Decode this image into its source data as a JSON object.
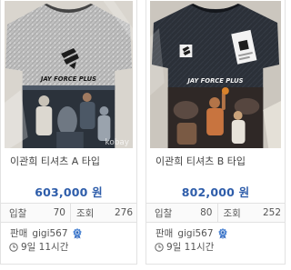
{
  "labels": {
    "bids": "입찰",
    "views": "조회",
    "seller": "판매"
  },
  "listings": [
    {
      "title": "이관희 티셔츠 A 타입",
      "price": "603,000 원",
      "bids": "70",
      "views": "276",
      "seller": "gigi567",
      "time_left": "9일 11시간",
      "image": {
        "print_text": "JAY FORCE PLUS",
        "watermark": "kobay"
      }
    },
    {
      "title": "이관희 티셔츠 B 타입",
      "price": "802,000 원",
      "bids": "80",
      "views": "252",
      "seller": "gigi567",
      "time_left": "9일 11시간",
      "image": {
        "print_text": "JAY FORCE PLUS"
      }
    }
  ],
  "icons": {
    "seller_badge": "rosette-badge-icon",
    "time": "clock-icon"
  },
  "colors": {
    "price": "#2e5daa",
    "seller_badge": "#4f86d4",
    "text": "#555555",
    "border": "#e2e2e2"
  }
}
